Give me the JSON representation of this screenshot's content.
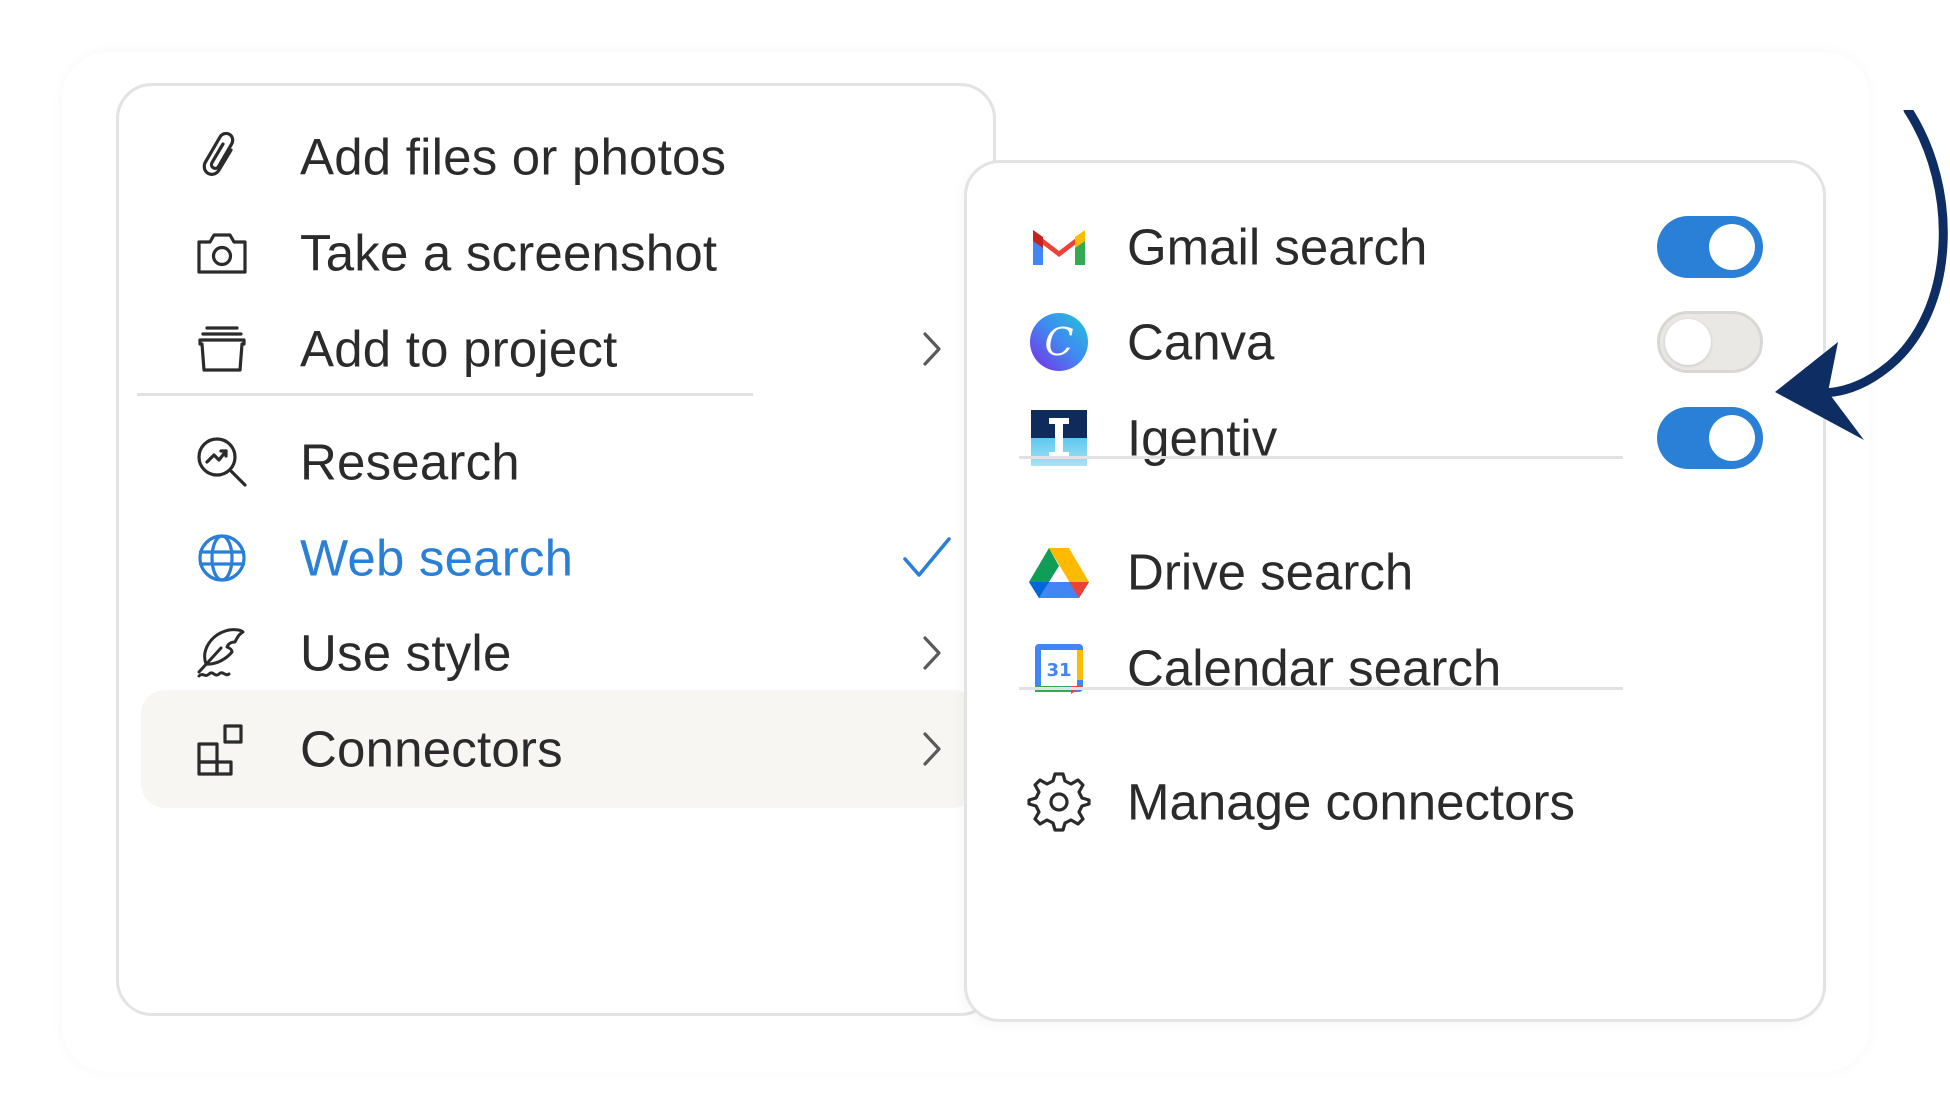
{
  "menu": {
    "items": [
      {
        "label": "Add files or photos",
        "icon": "paperclip-icon"
      },
      {
        "label": "Take a screenshot",
        "icon": "camera-icon"
      },
      {
        "label": "Add to project",
        "icon": "project-box-icon",
        "submenu": true
      },
      {
        "label": "Research",
        "icon": "research-magnifier-icon"
      },
      {
        "label": "Web search",
        "icon": "globe-icon",
        "checked": true
      },
      {
        "label": "Use style",
        "icon": "quill-icon",
        "submenu": true
      },
      {
        "label": "Connectors",
        "icon": "connectors-grid-icon",
        "submenu": true,
        "highlighted": true
      }
    ]
  },
  "connectors": {
    "items": [
      {
        "label": "Gmail search",
        "icon": "gmail-icon",
        "enabled": true
      },
      {
        "label": "Canva",
        "icon": "canva-icon",
        "enabled": false
      },
      {
        "label": "Igentiv",
        "icon": "igentiv-icon",
        "enabled": true
      },
      {
        "label": "Drive search",
        "icon": "google-drive-icon"
      },
      {
        "label": "Calendar search",
        "icon": "google-calendar-icon",
        "icon_text": "31"
      },
      {
        "label": "Manage connectors",
        "icon": "gear-icon"
      }
    ]
  },
  "colors": {
    "accent": "#2a7fd6",
    "text": "#2b2b2b",
    "toggle_off": "#e9e8e5",
    "arrow": "#0d2d63",
    "hover_bg": "#f7f6f3"
  },
  "annotation": {
    "icon": "curved-arrow-icon",
    "color": "#0d2d63"
  }
}
